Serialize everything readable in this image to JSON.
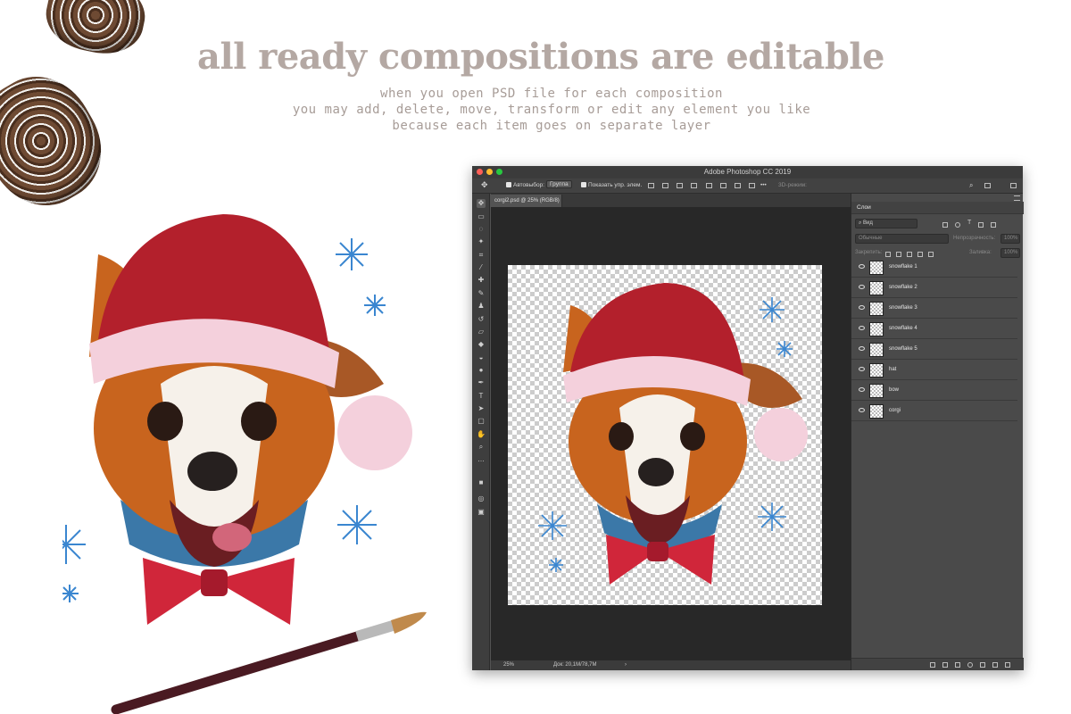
{
  "headline": "all ready compositions are editable",
  "subtitle_lines": [
    "when you open PSD file for each composition",
    "you may add, delete, move, transform or edit any element you like",
    "because each item goes on separate layer"
  ],
  "photoshop": {
    "title": "Adobe Photoshop CC 2019",
    "options": {
      "autoselect_label": "Автовыбор:",
      "autoselect_value": "Группа",
      "show_controls_label": "Показать упр. элем.",
      "mode_3d_label": "3D-режим:"
    },
    "document_tab": "corgi2.psd @ 25% (RGB/8)",
    "status": {
      "zoom": "25%",
      "doc_size": "Док: 20,1M/78,7M",
      "arrow": "›"
    },
    "layers_panel": {
      "tab_label": "Слои",
      "filter_value": "Вид",
      "blend_mode": "Обычные",
      "opacity_label": "Непрозрачность:",
      "opacity_value": "100%",
      "lock_label": "Закрепить:",
      "fill_label": "Заливка:",
      "fill_value": "100%",
      "layers": [
        {
          "name": "snowflake 1"
        },
        {
          "name": "snowflake 2"
        },
        {
          "name": "snowflake 3"
        },
        {
          "name": "snowflake 4"
        },
        {
          "name": "snowflake 5"
        },
        {
          "name": "hat"
        },
        {
          "name": "bow"
        },
        {
          "name": "corgi"
        }
      ]
    }
  },
  "colors": {
    "headline": "#b4a8a3",
    "hat_red": "#b3202c",
    "fur_orange": "#c8641e",
    "collar_blue": "#3b78a8",
    "bow_red": "#d0263a",
    "snowflake_blue": "#3a86d0"
  }
}
